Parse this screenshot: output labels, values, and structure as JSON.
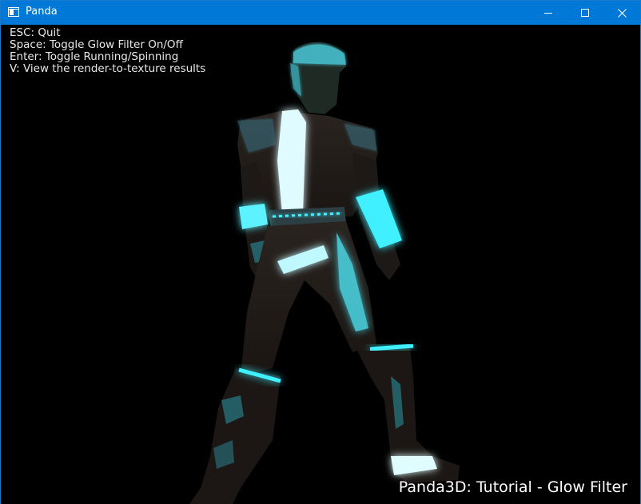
{
  "window": {
    "title": "Panda",
    "icon": "app-window-icon"
  },
  "titlebar_buttons": {
    "minimize": "minimize-icon",
    "maximize": "maximize-icon",
    "close": "close-icon"
  },
  "help": {
    "lines": [
      "ESC: Quit",
      "Space: Toggle Glow Filter On/Off",
      "Enter: Toggle Running/Spinning",
      "V: View the render-to-texture results"
    ]
  },
  "caption": "Panda3D: Tutorial - Glow Filter",
  "colors": {
    "titlebar": "#0078d7",
    "background": "#000000",
    "glow": "#3ff0ff"
  }
}
